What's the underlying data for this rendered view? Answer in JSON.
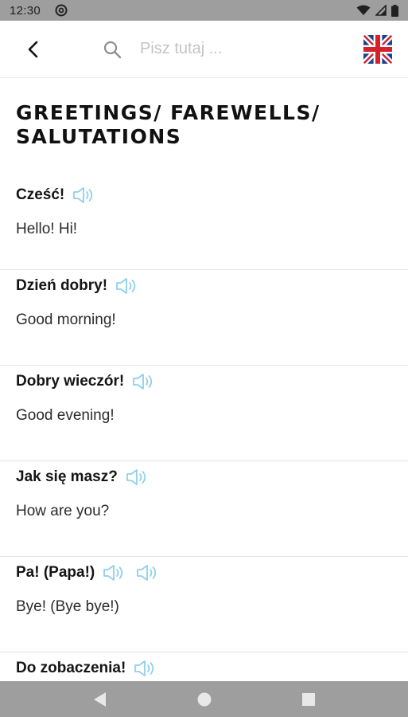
{
  "status": {
    "time": "12:30"
  },
  "header": {
    "search_placeholder": "Pisz tutaj ...",
    "flag_icon": "uk-flag-icon"
  },
  "section": {
    "title_line1": "GREETINGS/ FAREWELLS/",
    "title_line2": "SALUTATIONS"
  },
  "phrases": [
    {
      "pl": "Cześć!",
      "en": "Hello! Hi!",
      "speakers": 1
    },
    {
      "pl": "Dzień dobry!",
      "en": "Good morning!",
      "speakers": 1
    },
    {
      "pl": "Dobry wieczór!",
      "en": "Good evening!",
      "speakers": 1
    },
    {
      "pl": "Jak się masz?",
      "en": "How are you?",
      "speakers": 1
    },
    {
      "pl": "Pa! (Papa!)",
      "en": "Bye! (Bye bye!)",
      "speakers": 2
    },
    {
      "pl": "Do zobaczenia!",
      "en": "",
      "speakers": 1
    }
  ],
  "colors": {
    "speaker": "#8fd0ea",
    "system_bar": "#9e9e9e",
    "divider": "#e4e4e4"
  }
}
